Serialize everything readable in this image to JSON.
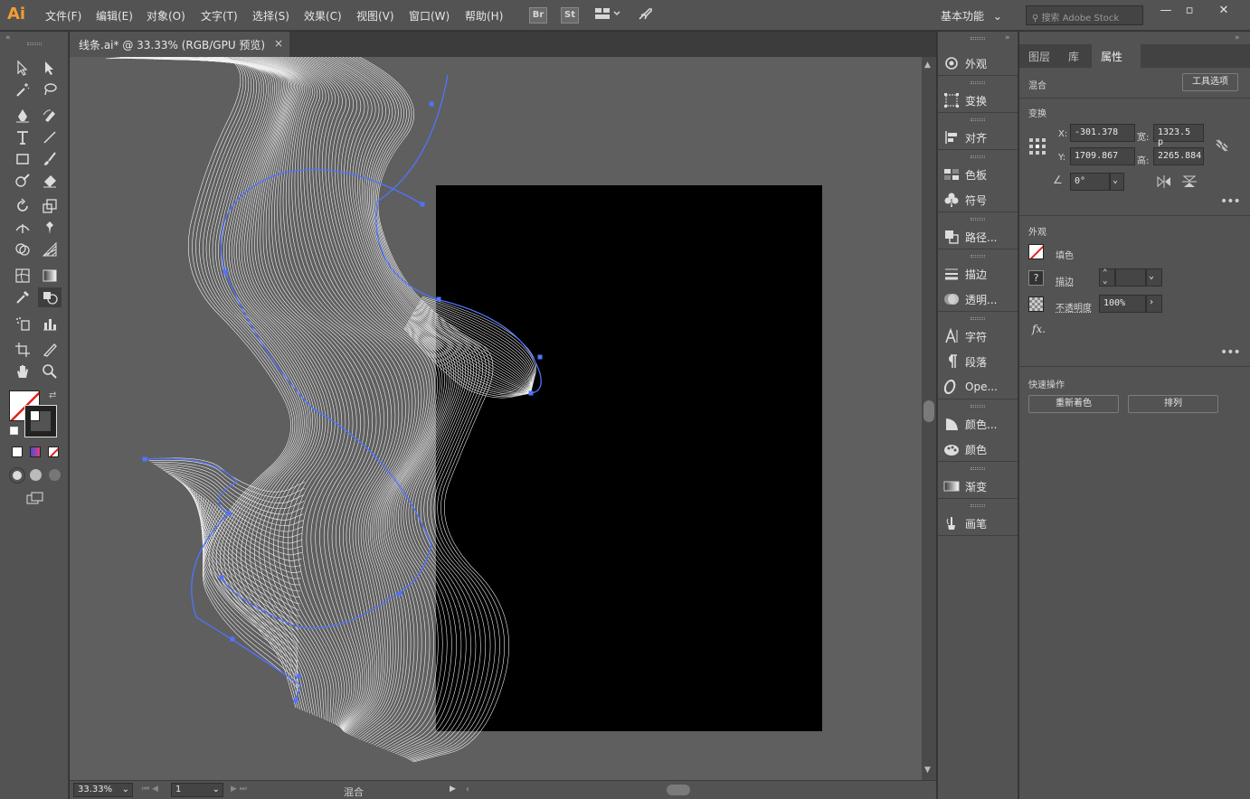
{
  "app": {
    "logo": "Ai"
  },
  "menu": [
    "文件(F)",
    "编辑(E)",
    "对象(O)",
    "文字(T)",
    "选择(S)",
    "效果(C)",
    "视图(V)",
    "窗口(W)",
    "帮助(H)"
  ],
  "menubar": {
    "br_label": "Br",
    "st_label": "St",
    "workspace": "基本功能",
    "search_placeholder": "搜索 Adobe Stock"
  },
  "document": {
    "tab_title": "线条.ai* @ 33.33% (RGB/GPU 预览)",
    "close": "×"
  },
  "status": {
    "zoom": "33.33%",
    "artboard": "1",
    "mode": "混合"
  },
  "dock": {
    "items": [
      {
        "icon": "appearance-icon",
        "label": "外观"
      },
      {
        "icon": "transform-icon",
        "label": "变换"
      },
      {
        "icon": "align-icon",
        "label": "对齐"
      },
      {
        "icon": "swatches-icon",
        "label": "色板"
      },
      {
        "icon": "symbols-icon",
        "label": "符号"
      },
      {
        "icon": "pathfinder-icon",
        "label": "路径..."
      },
      {
        "icon": "stroke-icon",
        "label": "描边"
      },
      {
        "icon": "transparency-icon",
        "label": "透明..."
      },
      {
        "icon": "character-icon",
        "label": "字符"
      },
      {
        "icon": "paragraph-icon",
        "label": "段落"
      },
      {
        "icon": "opentype-icon",
        "label": "Ope..."
      },
      {
        "icon": "color-guide-icon",
        "label": "颜色..."
      },
      {
        "icon": "color-icon",
        "label": "颜色"
      },
      {
        "icon": "gradient-icon",
        "label": "渐变"
      },
      {
        "icon": "brushes-icon",
        "label": "画笔"
      }
    ]
  },
  "properties": {
    "tabs": [
      "图层",
      "库",
      "属性"
    ],
    "active_tab": "属性",
    "object_type": "混合",
    "tool_options": "工具选项",
    "transform_title": "变换",
    "x_label": "X:",
    "x_value": "-301.378",
    "y_label": "Y:",
    "y_value": "1709.867",
    "w_label": "宽:",
    "w_value": "1323.5 p",
    "h_label": "高:",
    "h_value": "2265.884",
    "angle_value": "0°",
    "appearance_title": "外观",
    "fill_label": "填色",
    "stroke_label": "描边",
    "opacity_label": "不透明度",
    "opacity_value": "100%",
    "fx_label": "fx.",
    "quick_actions_title": "快速操作",
    "recolor_button": "重新着色",
    "arrange_button": "排列"
  }
}
